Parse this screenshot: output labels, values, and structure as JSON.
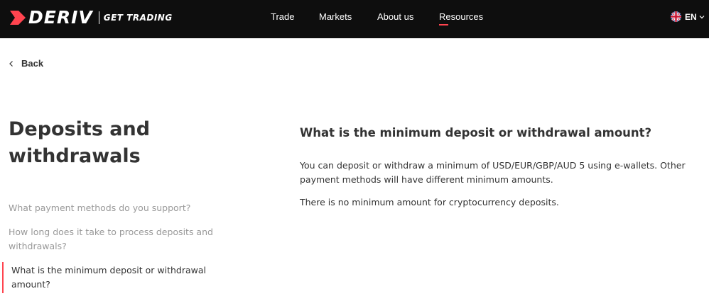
{
  "header": {
    "logo_text": "DERIV",
    "tagline": "GET TRADING",
    "nav": [
      {
        "label": "Trade"
      },
      {
        "label": "Markets"
      },
      {
        "label": "About us"
      },
      {
        "label": "Resources",
        "active": true
      }
    ],
    "language": "EN",
    "accent_color": "#ff444f"
  },
  "back_label": "Back",
  "page_title": "Deposits and withdrawals",
  "sidebar": {
    "items": [
      {
        "label": "What payment methods do you support?"
      },
      {
        "label": "How long does it take to process deposits and withdrawals?"
      },
      {
        "label": "What is the minimum deposit or withdrawal amount?",
        "active": true
      }
    ]
  },
  "content": {
    "question": "What is the minimum deposit or withdrawal amount?",
    "paragraphs": [
      "You can deposit or withdraw a minimum of USD/EUR/GBP/AUD 5 using e-wallets. Other payment methods will have different minimum amounts.",
      "There is no minimum amount for cryptocurrency deposits."
    ]
  }
}
